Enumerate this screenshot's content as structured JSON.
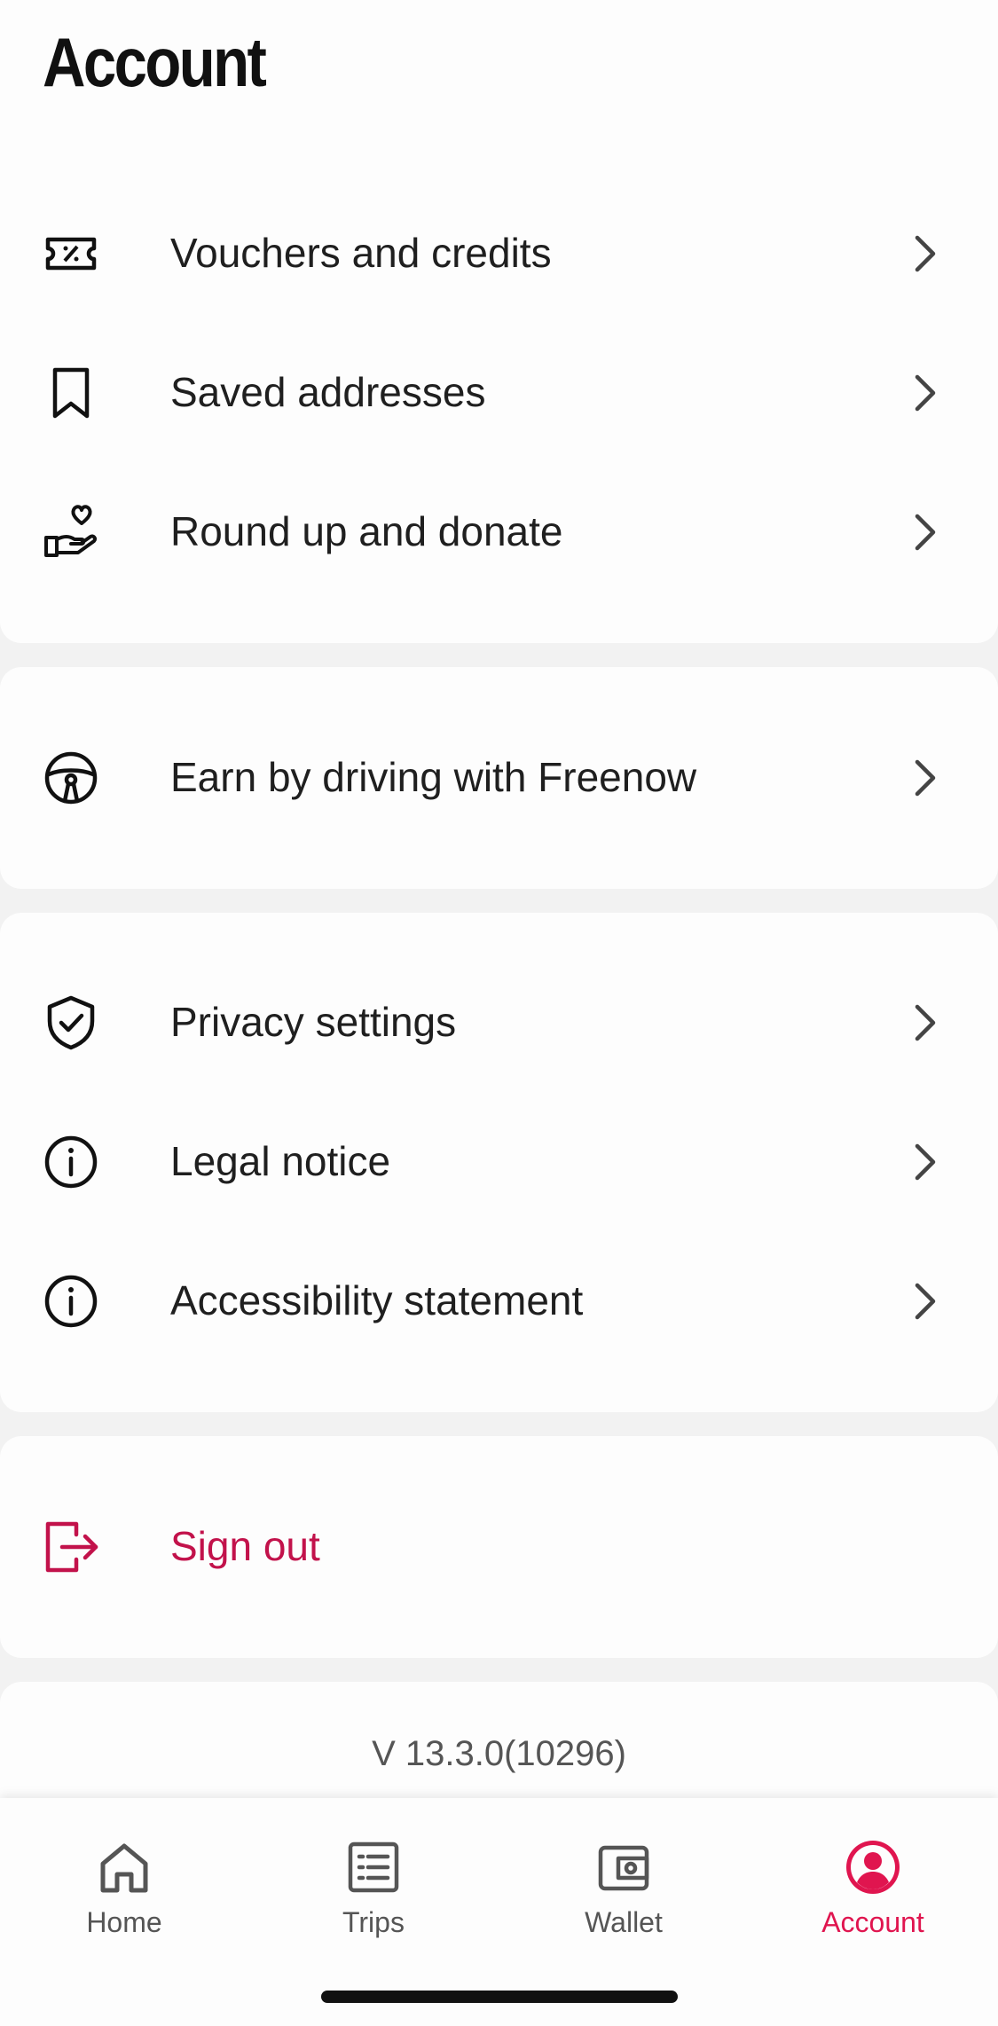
{
  "header": {
    "title": "Account"
  },
  "sections": {
    "rewards": [
      {
        "label": "Vouchers and credits",
        "icon": "voucher-icon"
      },
      {
        "label": "Saved addresses",
        "icon": "bookmark-icon"
      },
      {
        "label": "Round up and donate",
        "icon": "donate-hand-heart-icon"
      }
    ],
    "driving": [
      {
        "label": "Earn by driving with Freenow",
        "icon": "steering-wheel-icon"
      }
    ],
    "legal": [
      {
        "label": "Privacy settings",
        "icon": "shield-check-icon"
      },
      {
        "label": "Legal notice",
        "icon": "info-icon"
      },
      {
        "label": "Accessibility statement",
        "icon": "info-icon"
      }
    ],
    "session": {
      "signout_label": "Sign out",
      "icon": "sign-out-icon"
    }
  },
  "version": "V 13.3.0(10296)",
  "bottom_nav": {
    "items": [
      {
        "label": "Home",
        "icon": "home-icon",
        "active": false
      },
      {
        "label": "Trips",
        "icon": "trips-list-icon",
        "active": false
      },
      {
        "label": "Wallet",
        "icon": "wallet-icon",
        "active": false
      },
      {
        "label": "Account",
        "icon": "account-icon",
        "active": true
      }
    ]
  },
  "colors": {
    "accent": "#e0154f",
    "signout": "#c2124b",
    "background": "#f2f2f2",
    "card": "#fdfdfd",
    "text": "#1f1f1f",
    "muted": "#555555"
  }
}
